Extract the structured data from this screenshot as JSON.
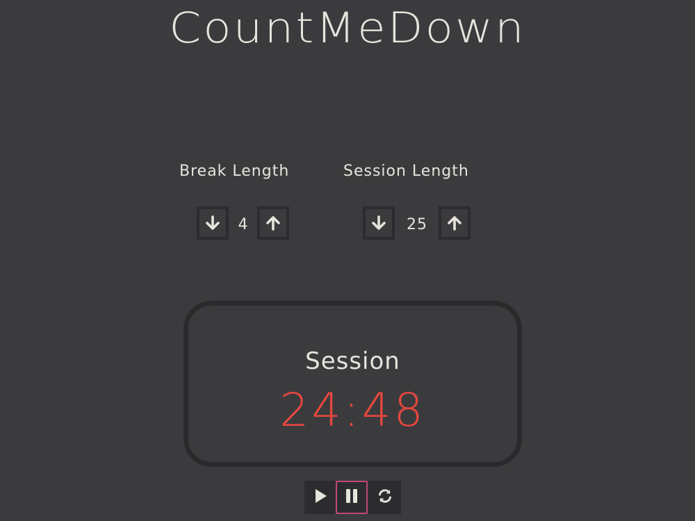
{
  "app": {
    "title": "CountMeDown"
  },
  "break": {
    "label": "Break Length",
    "value": "4"
  },
  "session": {
    "label": "Session Length",
    "value": "25"
  },
  "timer": {
    "label": "Session",
    "time": "24:48",
    "time_color": "#e8473f"
  },
  "icons": {
    "decrement": "arrow-down-icon",
    "increment": "arrow-up-icon",
    "play": "play-icon",
    "pause": "pause-icon",
    "reset": "refresh-icon"
  },
  "colors": {
    "background": "#3b3b3d",
    "dark": "#2c2c2e",
    "text": "#e6e4dc",
    "focus_outline": "#c0487a"
  }
}
